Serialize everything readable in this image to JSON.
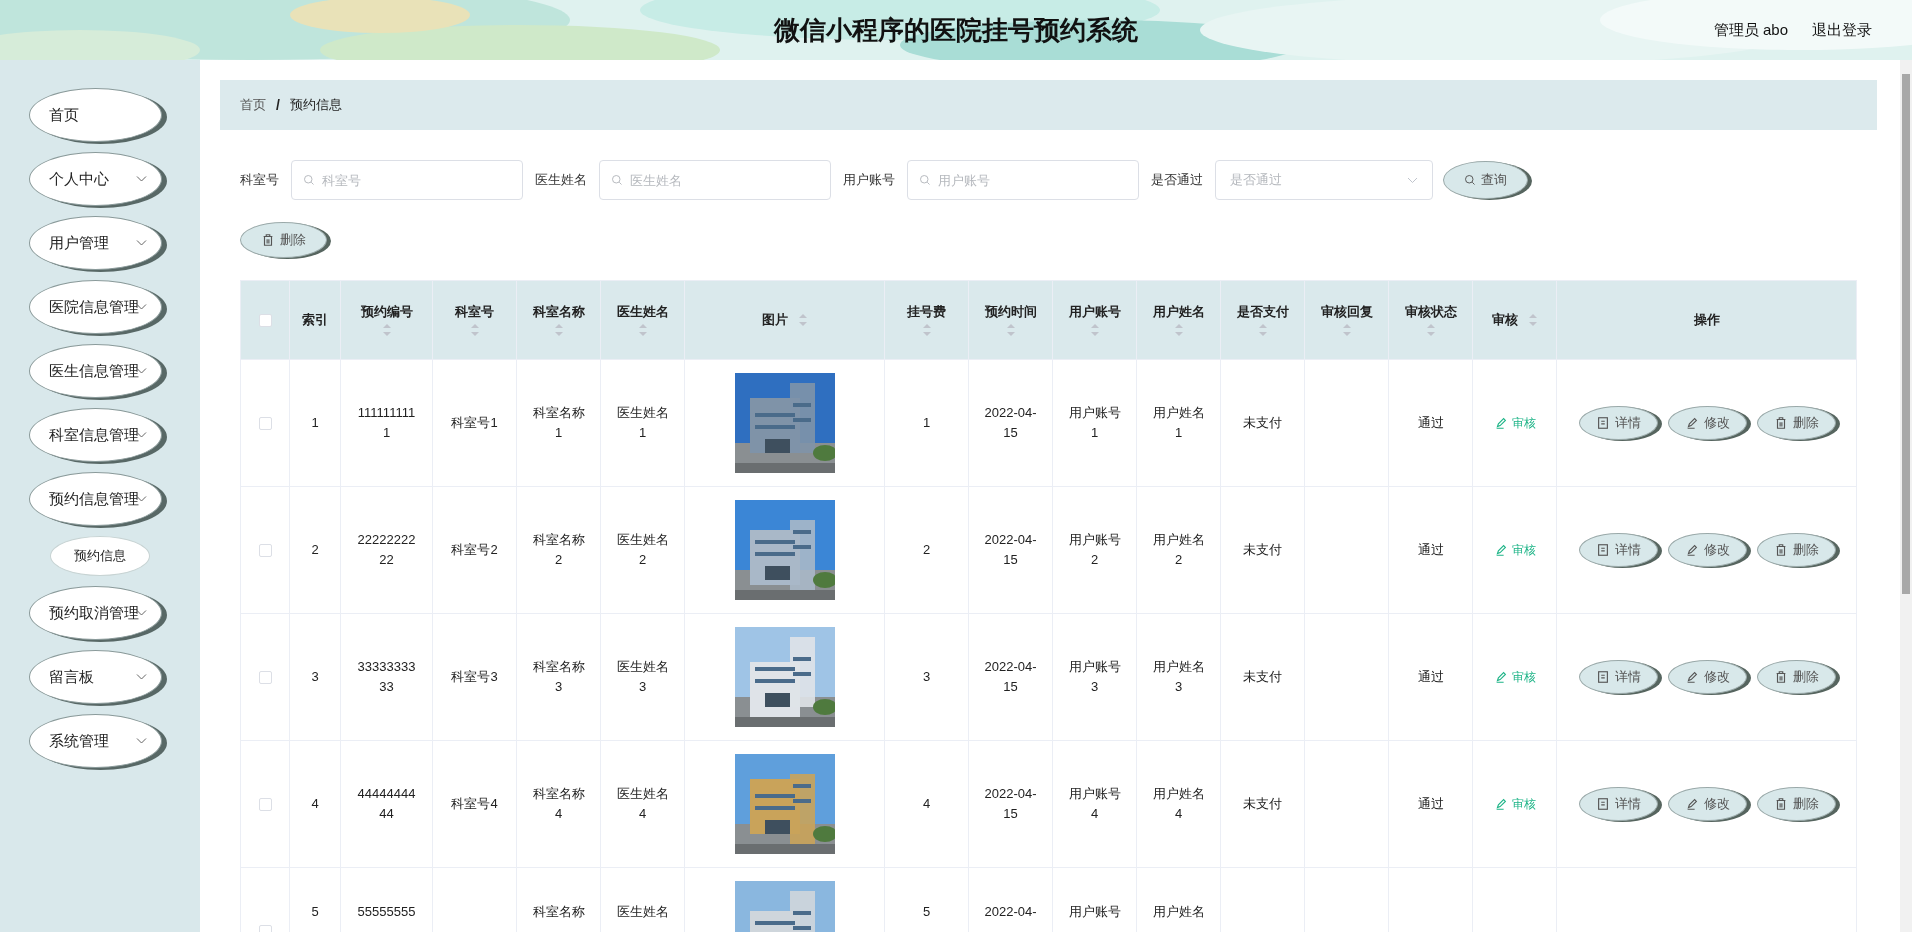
{
  "header": {
    "title": "微信小程序的医院挂号预约系统",
    "user": "管理员 abo",
    "logout": "退出登录"
  },
  "sidebar": {
    "items": [
      {
        "label": "首页",
        "submenu": false
      },
      {
        "label": "个人中心",
        "submenu": true
      },
      {
        "label": "用户管理",
        "submenu": true
      },
      {
        "label": "医院信息管理",
        "submenu": true
      },
      {
        "label": "医生信息管理",
        "submenu": true
      },
      {
        "label": "科室信息管理",
        "submenu": true
      },
      {
        "label": "预约信息管理",
        "submenu": true,
        "children": [
          {
            "label": "预约信息"
          }
        ]
      },
      {
        "label": "预约取消管理",
        "submenu": true
      },
      {
        "label": "留言板",
        "submenu": true
      },
      {
        "label": "系统管理",
        "submenu": true
      }
    ]
  },
  "breadcrumb": [
    {
      "label": "首页",
      "current": false
    },
    {
      "label": "预约信息",
      "current": true
    }
  ],
  "breadcrumb_separator": "/",
  "filters": [
    {
      "kind": "input",
      "label": "科室号",
      "placeholder": "科室号"
    },
    {
      "kind": "input",
      "label": "医生姓名",
      "placeholder": "医生姓名"
    },
    {
      "kind": "input",
      "label": "用户账号",
      "placeholder": "用户账号"
    },
    {
      "kind": "select",
      "label": "是否通过",
      "placeholder": "是否通过"
    }
  ],
  "search_button": "查询",
  "delete_button": "删除",
  "table": {
    "columns": [
      {
        "kind": "checkbox",
        "checked": false
      },
      {
        "kind": "text",
        "label": "索引",
        "sortable": false
      },
      {
        "kind": "text",
        "label": "预约编号",
        "sortable": true
      },
      {
        "kind": "text",
        "label": "科室号",
        "sortable": true
      },
      {
        "kind": "text",
        "label": "科室名称",
        "sortable": true
      },
      {
        "kind": "text",
        "label": "医生姓名",
        "sortable": true
      },
      {
        "kind": "picture",
        "label": "图片",
        "sortable": true
      },
      {
        "kind": "text",
        "label": "挂号费",
        "sortable": true
      },
      {
        "kind": "text",
        "label": "预约时间",
        "sortable": true
      },
      {
        "kind": "text",
        "label": "用户账号",
        "sortable": true
      },
      {
        "kind": "text",
        "label": "用户姓名",
        "sortable": true
      },
      {
        "kind": "text",
        "label": "是否支付",
        "sortable": true
      },
      {
        "kind": "text",
        "label": "审核回复",
        "sortable": true
      },
      {
        "kind": "text",
        "label": "审核状态",
        "sortable": true
      },
      {
        "kind": "link",
        "label": "审核",
        "sortable": true
      },
      {
        "kind": "actions",
        "label": "操作",
        "sortable": false
      }
    ],
    "rows": [
      {
        "checked": false,
        "cells": [
          null,
          "1",
          "1111111111",
          "科室号1",
          "科室名称1",
          "医生姓名1",
          {
            "kind": "picture"
          },
          "1",
          "2022-04-15",
          "用户账号1",
          "用户姓名1",
          "未支付",
          null,
          "通过",
          "审核",
          [
            {
              "kind": "detail",
              "label": "详情"
            },
            {
              "kind": "edit",
              "label": "修改"
            },
            {
              "kind": "delete",
              "label": "删除"
            }
          ]
        ]
      },
      {
        "checked": false,
        "cells": [
          null,
          "2",
          "2222222222",
          "科室号2",
          "科室名称2",
          "医生姓名2",
          {
            "kind": "picture"
          },
          "2",
          "2022-04-15",
          "用户账号2",
          "用户姓名2",
          "未支付",
          null,
          "通过",
          "审核",
          [
            {
              "kind": "detail",
              "label": "详情"
            },
            {
              "kind": "edit",
              "label": "修改"
            },
            {
              "kind": "delete",
              "label": "删除"
            }
          ]
        ]
      },
      {
        "checked": false,
        "cells": [
          null,
          "3",
          "3333333333",
          "科室号3",
          "科室名称3",
          "医生姓名3",
          {
            "kind": "picture"
          },
          "3",
          "2022-04-15",
          "用户账号3",
          "用户姓名3",
          "未支付",
          null,
          "通过",
          "审核",
          [
            {
              "kind": "detail",
              "label": "详情"
            },
            {
              "kind": "edit",
              "label": "修改"
            },
            {
              "kind": "delete",
              "label": "删除"
            }
          ]
        ]
      },
      {
        "checked": false,
        "cells": [
          null,
          "4",
          "4444444444",
          "科室号4",
          "科室名称4",
          "医生姓名4",
          {
            "kind": "picture"
          },
          "4",
          "2022-04-15",
          "用户账号4",
          "用户姓名4",
          "未支付",
          null,
          "通过",
          "审核",
          [
            {
              "kind": "detail",
              "label": "详情"
            },
            {
              "kind": "edit",
              "label": "修改"
            },
            {
              "kind": "delete",
              "label": "删除"
            }
          ]
        ]
      },
      {
        "checked": false,
        "cells": [
          null,
          "5",
          "55555555",
          null,
          "科室名称",
          "医生姓名",
          {
            "kind": "picture"
          },
          "5",
          "2022-04-",
          "用户账号",
          "用户姓名",
          null,
          null,
          null,
          null,
          null
        ]
      }
    ]
  }
}
